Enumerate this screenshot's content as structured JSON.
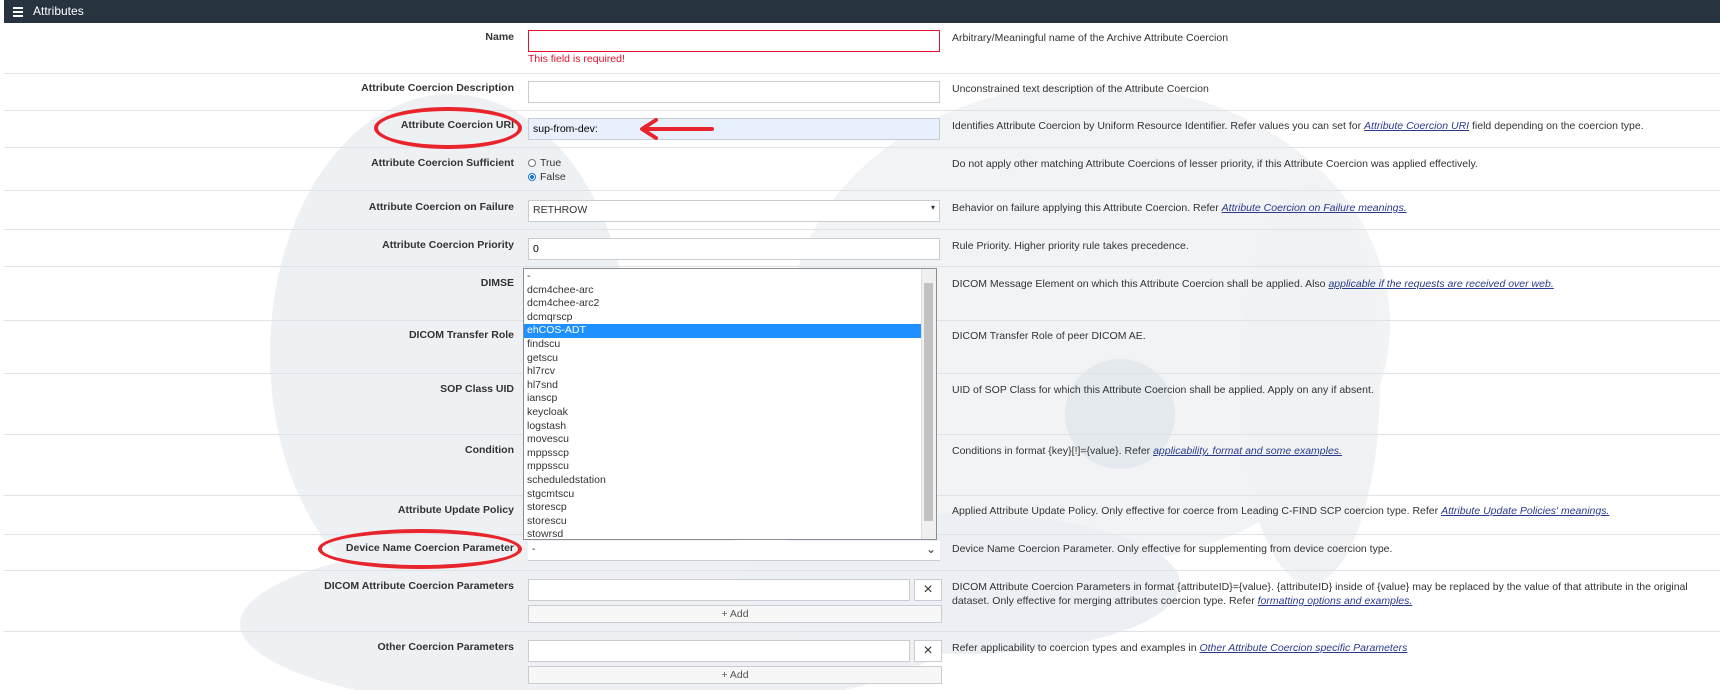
{
  "header": {
    "title": "Attributes"
  },
  "fields": {
    "name": {
      "label": "Name",
      "value": "",
      "error": "This field is required!",
      "help": "Arbitrary/Meaningful name of the Archive Attribute Coercion"
    },
    "description": {
      "label": "Attribute Coercion Description",
      "value": "",
      "help": "Unconstrained text description of the Attribute Coercion"
    },
    "uri": {
      "label": "Attribute Coercion URI",
      "value": "sup-from-dev:",
      "help_pre": "Identifies Attribute Coercion by Uniform Resource Identifier. Refer values you can set for ",
      "help_link": "Attribute Coercion URI",
      "help_post": " field depending on the coercion type."
    },
    "sufficient": {
      "label": "Attribute Coercion Sufficient",
      "options": [
        "True",
        "False"
      ],
      "selected": "False",
      "help": "Do not apply other matching Attribute Coercions of lesser priority, if this Attribute Coercion was applied effectively."
    },
    "on_failure": {
      "label": "Attribute Coercion on Failure",
      "value": "RETHROW",
      "help_pre": "Behavior on failure applying this Attribute Coercion. Refer ",
      "help_link": "Attribute Coercion on Failure meanings."
    },
    "priority": {
      "label": "Attribute Coercion Priority",
      "value": "0",
      "help": "Rule Priority. Higher priority rule takes precedence."
    },
    "dimse": {
      "label": "DIMSE",
      "help_pre": "DICOM Message Element on which this Attribute Coercion shall be applied. Also ",
      "help_link": "applicable if the requests are received over web."
    },
    "transfer_role": {
      "label": "DICOM Transfer Role",
      "help": "DICOM Transfer Role of peer DICOM AE."
    },
    "sop_class": {
      "label": "SOP Class UID",
      "help": "UID of SOP Class for which this Attribute Coercion shall be applied. Apply on any if absent."
    },
    "condition": {
      "label": "Condition",
      "help_pre": "Conditions in format {key}[!]={value}. Refer ",
      "help_link": "applicability, format and some examples."
    },
    "update_policy": {
      "label": "Attribute Update Policy",
      "help_pre": "Applied Attribute Update Policy. Only effective for coerce from Leading C-FIND SCP coercion type. Refer ",
      "help_link": "Attribute Update Policies' meanings."
    },
    "device_name": {
      "label": "Device Name Coercion Parameter",
      "value": "-",
      "help": "Device Name Coercion Parameter. Only effective for supplementing from device coercion type."
    },
    "dicom_params": {
      "label": "DICOM Attribute Coercion Parameters",
      "help_pre": "DICOM Attribute Coercion Parameters in format {attributeID}={value}. {attributeID} inside of {value} may be replaced by the value of that attribute in the original dataset. Only effective for merging attributes coercion type. Refer ",
      "help_link": "formatting options and examples.",
      "add_label": "Add"
    },
    "other_params": {
      "label": "Other Coercion Parameters",
      "help_pre": "Refer applicability to coercion types and examples in ",
      "help_link": "Other Attribute Coercion specific Parameters",
      "add_label": "Add"
    }
  },
  "device_list": {
    "options": [
      "-",
      "dcm4chee-arc",
      "dcm4chee-arc2",
      "dcmqrscp",
      "ehCOS-ADT",
      "findscu",
      "getscu",
      "hl7rcv",
      "hl7snd",
      "ianscp",
      "keycloak",
      "logstash",
      "movescu",
      "mppsscp",
      "mppsscu",
      "scheduledstation",
      "stgcmtscu",
      "storescp",
      "storescu",
      "stowrsd"
    ],
    "selected": "ehCOS-ADT"
  },
  "accent": {
    "annotation": "#e8242c",
    "header_bg": "#27333f",
    "selection": "#1e90ff"
  }
}
